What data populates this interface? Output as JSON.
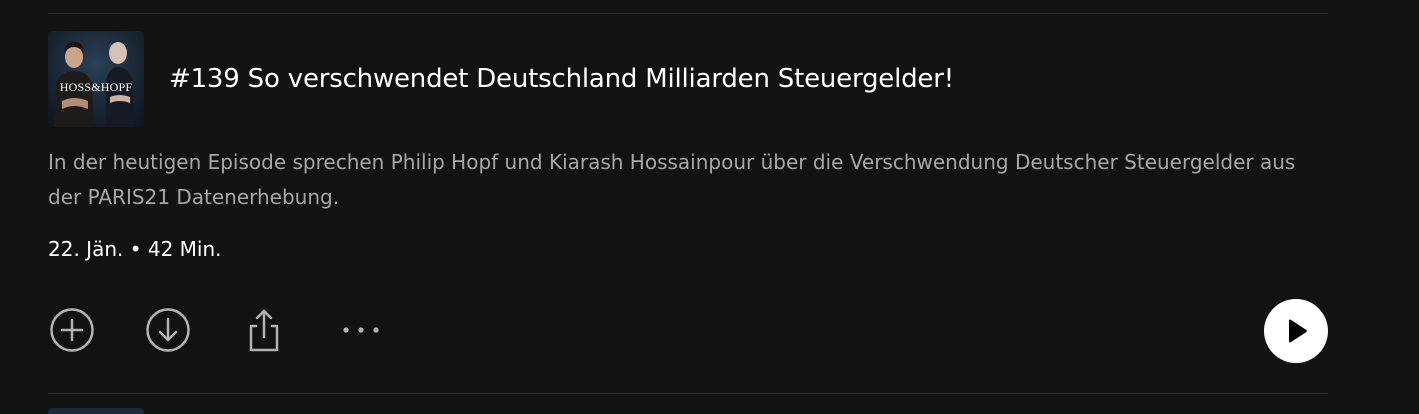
{
  "episode": {
    "cover_text": "HOSS&HOPF",
    "title": "#139 So verschwendet Deutschland Milliarden Steuergelder!",
    "description": "In der heutigen Episode sprechen Philip Hopf und Kiarash Hossainpour über die Verschwendung Deutscher Steuergelder aus der PARIS21 Datenerhebung.",
    "meta": "22. Jän. • 42 Min."
  },
  "actions": {
    "add_icon": "plus-circle-icon",
    "download_icon": "download-circle-icon",
    "share_icon": "share-icon",
    "more_icon": "more-dots-icon",
    "play_icon": "play-icon"
  },
  "colors": {
    "background": "#121212",
    "text_primary": "#ffffff",
    "text_secondary": "#a7a7a7",
    "divider": "#2e2e2e",
    "play_button_bg": "#ffffff"
  }
}
